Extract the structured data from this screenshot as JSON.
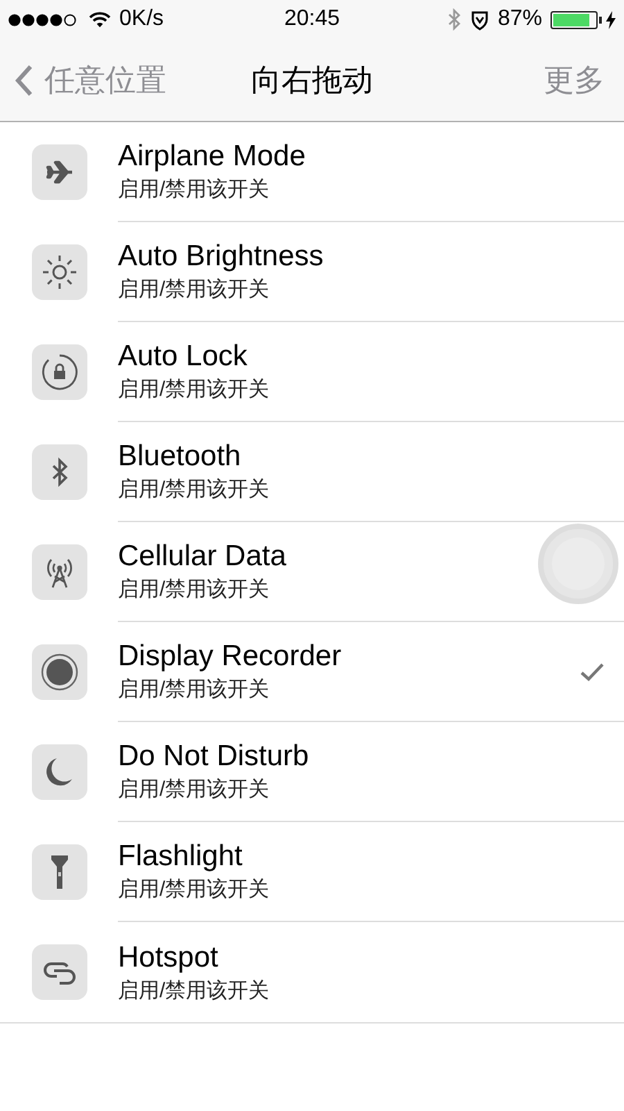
{
  "status_bar": {
    "speed": "0K/s",
    "time": "20:45",
    "battery_percent": "87%"
  },
  "nav": {
    "back": "任意位置",
    "title": "向右拖动",
    "action": "更多"
  },
  "items": [
    {
      "title": "Airplane Mode",
      "subtitle": "启用/禁用该开关",
      "checked": false
    },
    {
      "title": "Auto Brightness",
      "subtitle": "启用/禁用该开关",
      "checked": false
    },
    {
      "title": "Auto Lock",
      "subtitle": "启用/禁用该开关",
      "checked": false
    },
    {
      "title": "Bluetooth",
      "subtitle": "启用/禁用该开关",
      "checked": false
    },
    {
      "title": "Cellular Data",
      "subtitle": "启用/禁用该开关",
      "checked": false
    },
    {
      "title": "Display Recorder",
      "subtitle": "启用/禁用该开关",
      "checked": true
    },
    {
      "title": "Do Not Disturb",
      "subtitle": "启用/禁用该开关",
      "checked": false
    },
    {
      "title": "Flashlight",
      "subtitle": "启用/禁用该开关",
      "checked": false
    },
    {
      "title": "Hotspot",
      "subtitle": "启用/禁用该开关",
      "checked": false
    }
  ]
}
